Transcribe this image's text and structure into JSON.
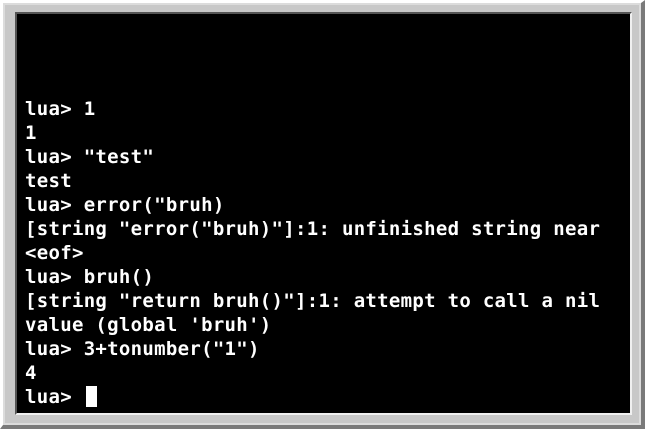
{
  "terminal": {
    "prompt": "lua> ",
    "lines": [
      "lua> 1",
      "1",
      "lua> \"test\"",
      "test",
      "lua> error(\"bruh)",
      "[string \"error(\"bruh)\"]:1: unfinished string near",
      "<eof>",
      "lua> bruh()",
      "[string \"return bruh()\"]:1: attempt to call a nil",
      "value (global 'bruh')",
      "lua> 3+tonumber(\"1\")",
      "4"
    ],
    "current_input": ""
  },
  "colors": {
    "background": "#000000",
    "text": "#ffffff",
    "bezel": "#c8c8c8"
  }
}
